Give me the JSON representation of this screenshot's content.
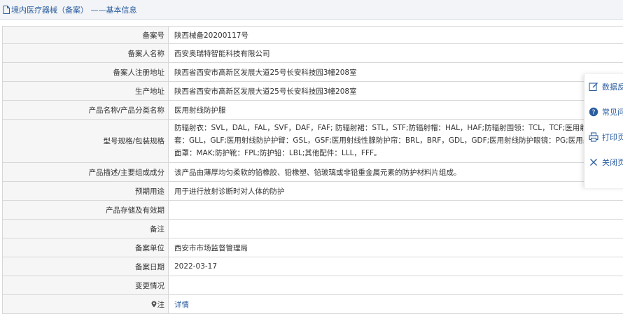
{
  "header": {
    "title": "境内医疗器械（备案） ——基本信息"
  },
  "fields": [
    {
      "label": "备案号",
      "value": "陕西械备20200117号"
    },
    {
      "label": "备案人名称",
      "value": "西安奥瑞特智能科技有限公司"
    },
    {
      "label": "备案人注册地址",
      "value": "陕西省西安市高新区发展大道25号长安科技园3幢208室"
    },
    {
      "label": "生产地址",
      "value": "陕西省西安市高新区发展大道25号长安科技园3幢208室"
    },
    {
      "label": "产品名称/产品分类名称",
      "value": "医用射线防护服"
    },
    {
      "label": "型号规格/包装规格",
      "lines": [
        "防辐射衣：SVL，DAL，FAL，SVF，DAF，FAF; 防辐射裙：STL，STF;防辐射帽：HAL，HAF;防辐射围领：TCL，TCF;医用射线防护手",
        "套：GLL，GLF;医用射线防护护臂：GSL，GSF;医用射线性腺防护帘：BRL，BRF，GDL，GDF;医用射线防护眼镜：PG;医用射线防护",
        "面罩：MAK;防护靴：FPL;防护铅：LBL;其他配件：LLL，FFF。"
      ]
    },
    {
      "label": "产品描述/主要组成成分",
      "value": "该产品由薄厚均匀柔软的铅橡胶、铅橡塑、铅玻璃或非铅重金属元素的防护材料片组成。"
    },
    {
      "label": "预期用途",
      "value": "用于进行放射诊断时对人体的防护"
    },
    {
      "label": "产品存储及有效期",
      "value": ""
    },
    {
      "label": "备注",
      "value": ""
    },
    {
      "label": "备案单位",
      "value": "西安市市场监督管理局"
    },
    {
      "label": "备案日期",
      "value": "2022-03-17"
    },
    {
      "label": "变更情况",
      "value": ""
    },
    {
      "label": "注",
      "value": "详情"
    }
  ],
  "side_panel": {
    "items": [
      {
        "label": "数据反",
        "icon": "edit-icon"
      },
      {
        "label": "常见问",
        "icon": "help-icon"
      },
      {
        "label": "打印页",
        "icon": "print-icon"
      },
      {
        "label": "关闭页",
        "icon": "close-icon"
      }
    ]
  },
  "colors": {
    "link": "#2a5d9f",
    "label_bg": "#f6f6f6",
    "header_bg": "#f2f4f7",
    "border": "#d7d7d7"
  }
}
